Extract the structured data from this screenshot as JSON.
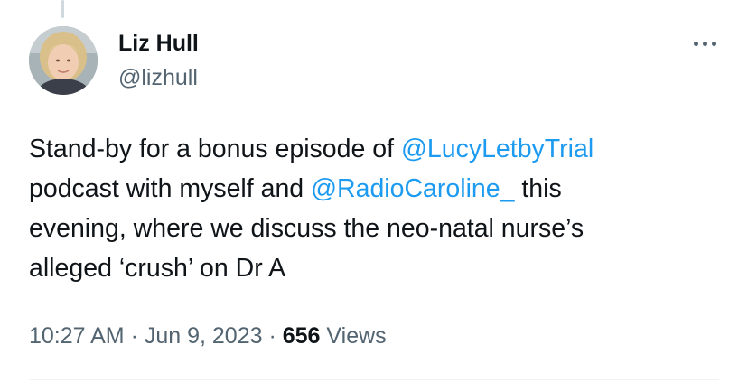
{
  "tweet": {
    "author": {
      "display_name": "Liz Hull",
      "handle": "@lizhull",
      "avatar_icon": "profile-photo"
    },
    "more_icon": "more-horizontal-icon",
    "text": {
      "line1_before": "Stand-by for a bonus episode of ",
      "mention1": "@LucyLetbyTrial",
      "line2_before": "podcast with myself and ",
      "mention2": "@RadioCaroline_",
      "line2_after": " this",
      "line3": "evening, where we discuss the neo-natal nurse’s",
      "line4": "alleged ‘crush’ on Dr A"
    },
    "meta": {
      "time": "10:27 AM",
      "separator1": " · ",
      "date": "Jun 9, 2023",
      "separator2": " · ",
      "views_count": "656",
      "views_label": " Views"
    },
    "colors": {
      "text": "#0f1419",
      "secondary": "#536471",
      "link": "#1d9bf0"
    }
  }
}
